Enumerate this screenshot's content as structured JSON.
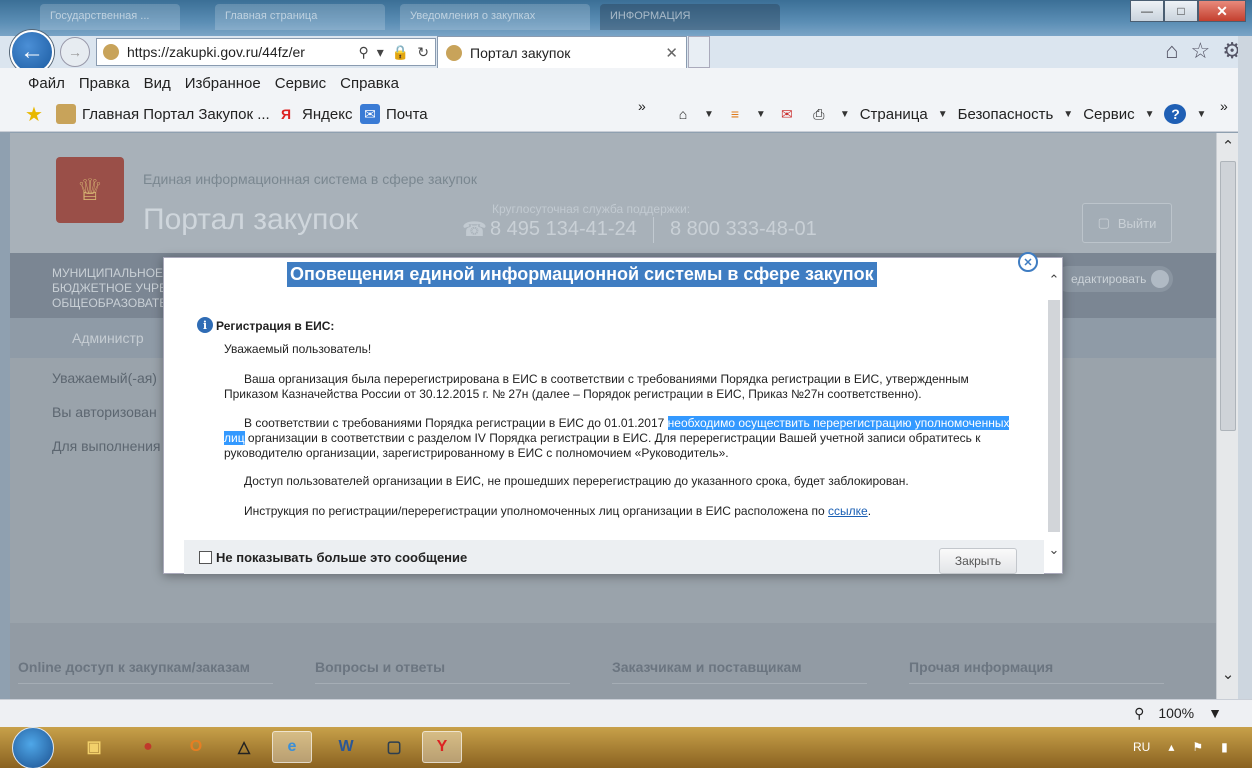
{
  "browser": {
    "background_tabs": [
      "Государственная ...",
      "Главная страница",
      "Уведомления о закупках",
      "ИНФОРМАЦИЯ"
    ],
    "address_url": "https://zakupki.gov.ru/44fz/er",
    "active_tab_title": "Портал закупок",
    "window_buttons": {
      "minimize": "—",
      "maximize": "□",
      "close": "✕"
    }
  },
  "menu": [
    "Файл",
    "Правка",
    "Вид",
    "Избранное",
    "Сервис",
    "Справка"
  ],
  "favorites": [
    {
      "label": "Главная Портал Закупок ...",
      "icon": "eagle-icon"
    },
    {
      "label": "Яндекс",
      "icon": "yandex-icon"
    },
    {
      "label": "Почта",
      "icon": "mail-icon"
    }
  ],
  "commands": {
    "page": "Страница",
    "security": "Безопасность",
    "tools": "Сервис"
  },
  "page": {
    "eis_label": "Единая информационная система в сфере закупок",
    "portal_title": "Портал закупок",
    "support_label": "Круглосуточная служба поддержки:",
    "phone1": "8 495 134-41-24",
    "phone2": "8 800 333-48-01",
    "logout": "Выйти",
    "org_lines": [
      "МУНИЦИПАЛЬНОЕ С",
      "БЮДЖЕТНОЕ УЧРЕЖ",
      "ОБЩЕОБРАЗОВАТЕ"
    ],
    "edit_label": "едактировать",
    "admin_tab": "Администр",
    "lines": [
      "Уважаемый(-ая)",
      "Вы авторизован",
      "Для выполнения"
    ],
    "footer": [
      "Online доступ к закупкам/заказам",
      "Вопросы и ответы",
      "Заказчикам и поставщикам",
      "Прочая информация"
    ]
  },
  "modal": {
    "title": "Оповещения единой информационной системы в сфере закупок",
    "section_title": "Регистрация в ЕИС:",
    "greeting": "Уважаемый пользователь!",
    "para1": "Ваша организация была перерегистрирована в ЕИС в соответствии с требованиями Порядка регистрации в ЕИС, утвержденным Приказом Казначейства России от 30.12.2015 г. № 27н (далее – Порядок регистрации в ЕИС, Приказ №27н соответственно).",
    "para2_before": "В соответствии с требованиями Порядка регистрации в ЕИС до 01.01.2017 ",
    "para2_highlight": "необходимо осуществить перерегистрацию уполномоченных лиц",
    "para2_after": " организации в соответствии с разделом IV Порядка регистрации в ЕИС. Для перерегистрации Вашей учетной записи обратитесь к руководителю организации, зарегистрированному в ЕИС с полномочием «Руководитель».",
    "para3": "Доступ пользователей организации в ЕИС, не прошедших перерегистрацию до указанного срока, будет заблокирован.",
    "para4_before": "Инструкция по регистрации/перерегистрации уполномоченных лиц организации в ЕИС расположена по ",
    "para4_link": "ссылке",
    "para4_after": ".",
    "dont_show": "Не показывать больше это сообщение",
    "close_button": "Закрыть"
  },
  "status": {
    "zoom": "100%"
  },
  "taskbar": {
    "lang": "RU"
  }
}
